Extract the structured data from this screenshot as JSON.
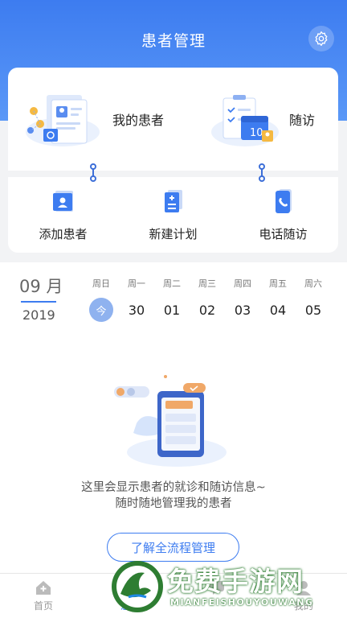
{
  "header": {
    "title": "患者管理",
    "settings_icon": "gear-icon"
  },
  "top_items": [
    {
      "label": "我的患者",
      "icon": "patients-illustration"
    },
    {
      "label": "随访",
      "icon": "calendar-illustration",
      "calendar_number": "10"
    }
  ],
  "actions": [
    {
      "label": "添加患者",
      "icon": "id-card-icon"
    },
    {
      "label": "新建计划",
      "icon": "plan-doc-icon"
    },
    {
      "label": "电话随访",
      "icon": "phone-icon"
    }
  ],
  "date": {
    "month": "09 月",
    "year": "2019",
    "weekdays": [
      "周日",
      "周一",
      "周二",
      "周三",
      "周四",
      "周五",
      "周六"
    ],
    "days": [
      "今",
      "30",
      "01",
      "02",
      "03",
      "04",
      "05"
    ]
  },
  "empty": {
    "line1": "这里会显示患者的就诊和随访信息~",
    "line2": "随时随地管理我的患者",
    "button": "了解全流程管理"
  },
  "nav": [
    {
      "label": "首页",
      "icon": "home-icon"
    },
    {
      "label": "患者",
      "icon": "patients-icon"
    },
    {
      "label": "",
      "icon": "chat-icon"
    },
    {
      "label": "我的",
      "icon": "profile-icon"
    }
  ],
  "watermark": {
    "text": "免费手游网",
    "sub": "MIANFEISHOUYOUWANG"
  },
  "colors": {
    "primary": "#3d7cf0",
    "today": "#8fb2ef"
  }
}
